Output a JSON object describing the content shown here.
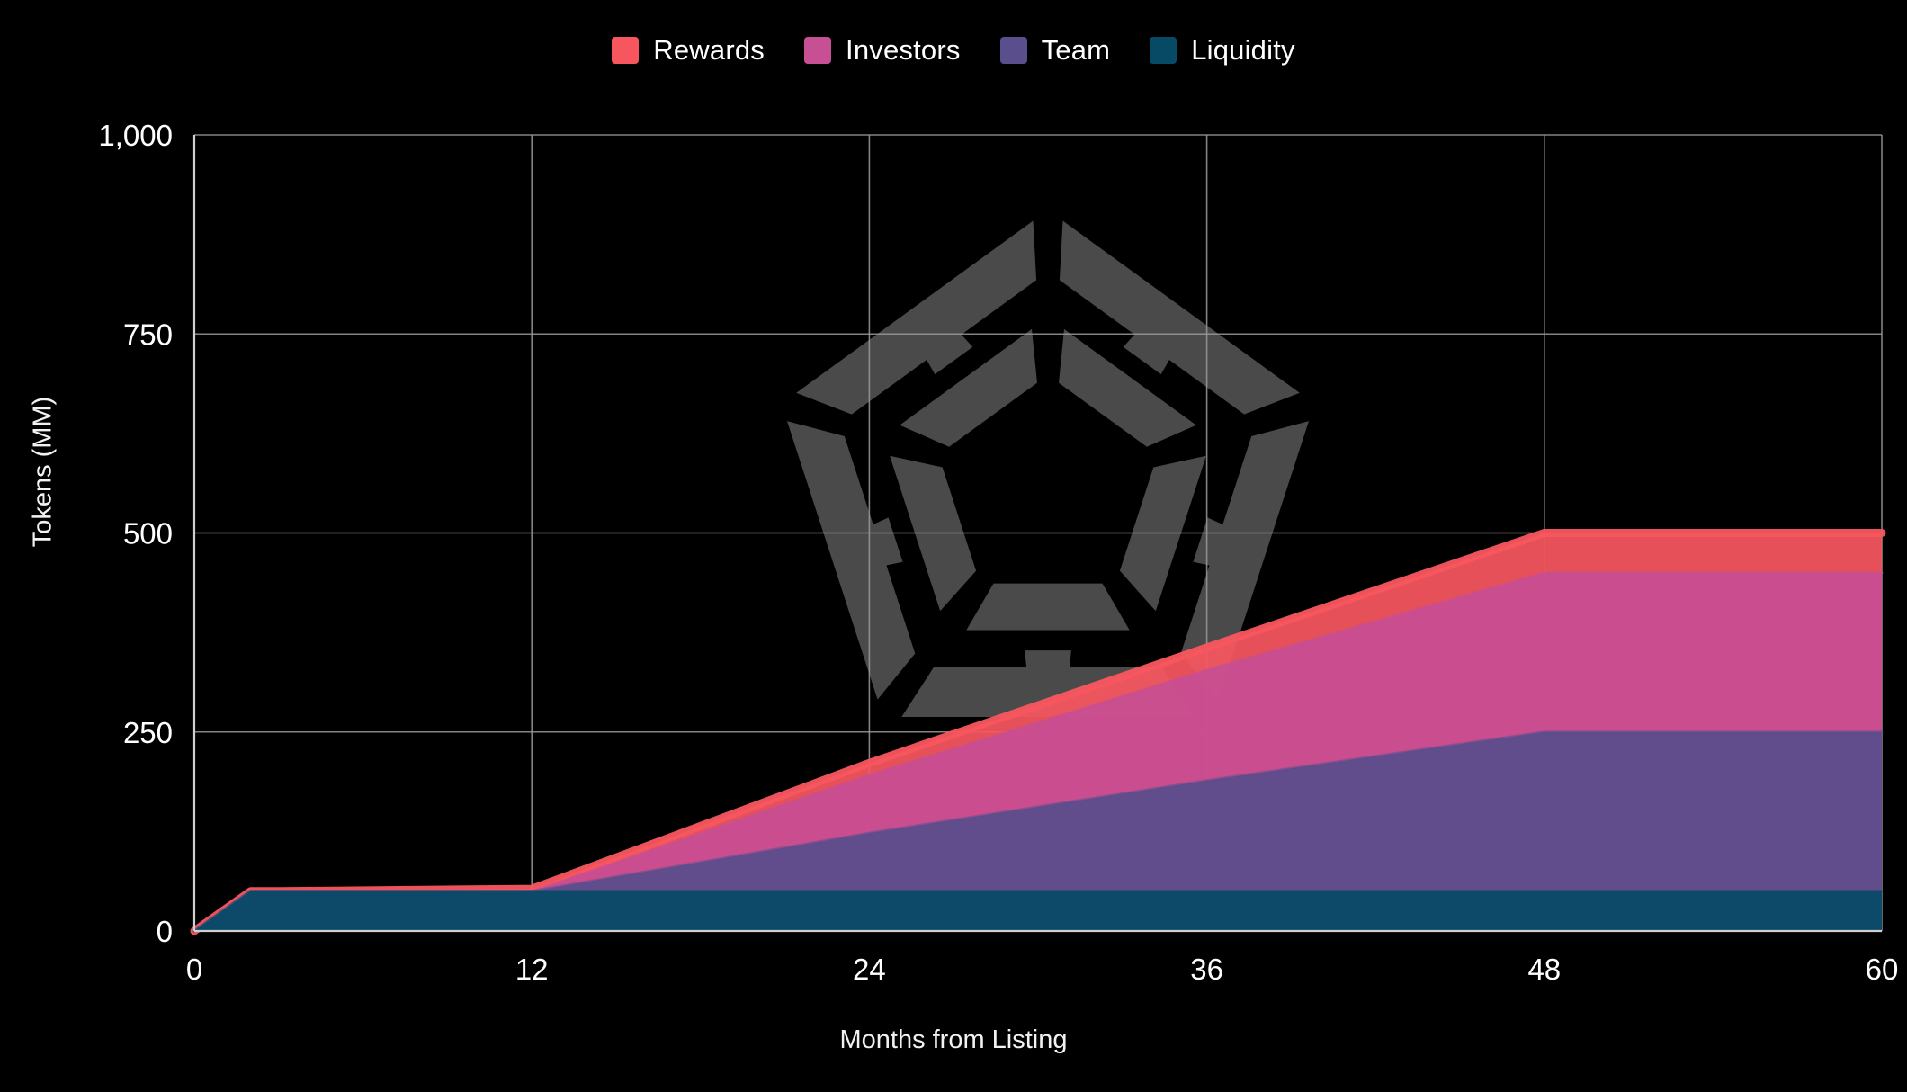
{
  "chart_data": {
    "type": "area",
    "stacked": true,
    "title": "",
    "subtitle": "",
    "xlabel": "Months from Listing",
    "ylabel": "Tokens (MM)",
    "xlim": [
      0,
      60
    ],
    "ylim": [
      0,
      1000
    ],
    "xticks": [
      0,
      12,
      24,
      36,
      48,
      60
    ],
    "yticks": [
      0,
      250,
      500,
      750,
      1000
    ],
    "ytick_labels": [
      "0",
      "250",
      "500",
      "750",
      "1,000"
    ],
    "xtick_labels": [
      "0",
      "12",
      "24",
      "36",
      "48",
      "60"
    ],
    "grid": true,
    "grid_color": "#9a9a9a",
    "background": "#000000",
    "legend_position": "top",
    "x": [
      0,
      2,
      3,
      12,
      13,
      24,
      36,
      48,
      60
    ],
    "series": [
      {
        "name": "Liquidity",
        "color": "#064a66",
        "values": [
          0,
          50,
          50,
          50,
          50,
          50,
          50,
          50,
          50
        ]
      },
      {
        "name": "Team",
        "color": "#5a4e8c",
        "values": [
          0,
          0,
          0,
          0,
          6,
          73,
          139,
          200,
          200
        ]
      },
      {
        "name": "Investors",
        "color": "#c74f93",
        "values": [
          0,
          0,
          0,
          0,
          6,
          73,
          139,
          200,
          200
        ]
      },
      {
        "name": "Rewards",
        "color": "#f8565f",
        "values": [
          0,
          0,
          0,
          3,
          4,
          15,
          28,
          50,
          50
        ]
      }
    ],
    "cumulative_totals": [
      0,
      50,
      50,
      53,
      66,
      211,
      356,
      500,
      500
    ],
    "plateau_note": "Totals plateau at 500 MM from month 48 onward",
    "series_plateau_tops": {
      "Liquidity": 50,
      "Team": 250,
      "Investors": 450,
      "Rewards": 500
    }
  },
  "legend": {
    "items": [
      {
        "label": "Rewards",
        "color": "#f8565f"
      },
      {
        "label": "Investors",
        "color": "#c74f93"
      },
      {
        "label": "Team",
        "color": "#5a4e8c"
      },
      {
        "label": "Liquidity",
        "color": "#064a66"
      }
    ]
  },
  "watermark": {
    "name": "pentagon-ribbon-logo",
    "color": "#4a4a4a"
  }
}
